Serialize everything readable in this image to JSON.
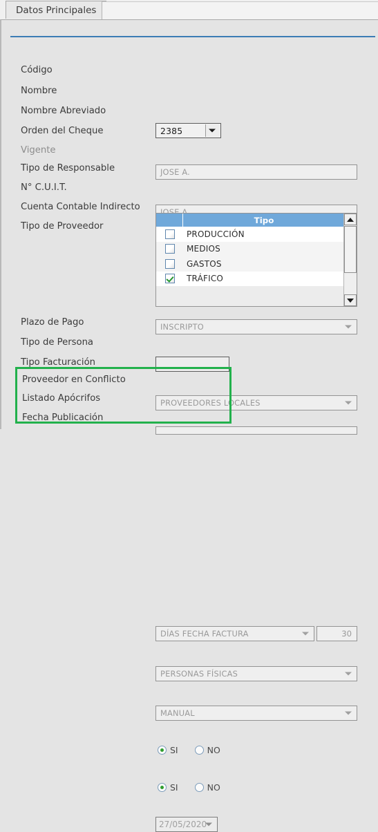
{
  "window": {
    "tab_label": "Datos Principales"
  },
  "form": {
    "rows": [
      {
        "label": "Código",
        "value": "2385",
        "control": "combo-enabled"
      },
      {
        "label": "Nombre",
        "value": "JOSE A.",
        "control": "text"
      },
      {
        "label": "Nombre Abreviado",
        "value": "JOSE A.",
        "control": "text"
      },
      {
        "label": "Orden del Cheque",
        "value": "JOSE A.",
        "control": "text"
      },
      {
        "label": "Vigente",
        "value": "",
        "control": "radio"
      },
      {
        "label": "Tipo de Responsable",
        "value": "INSCRIPTO",
        "control": "combo"
      },
      {
        "label": "N° C.U.I.T.",
        "value": "",
        "control": "text-empty"
      },
      {
        "label": "Cuenta Contable Indirecto",
        "value": "PROVEEDORES LOCALES",
        "control": "combo"
      },
      {
        "label": "Tipo de Proveedor",
        "value": "",
        "control": "grid"
      },
      {
        "label": "Plazo de Pago",
        "value": "DÍAS FECHA FACTURA",
        "control": "combo-num"
      },
      {
        "label": "Tipo de Persona",
        "value": "PERSONAS FÍSICAS",
        "control": "combo"
      },
      {
        "label": "Tipo Facturación",
        "value": "MANUAL",
        "control": "combo"
      },
      {
        "label": "Proveedor en Conflicto",
        "value": "",
        "control": "radio"
      },
      {
        "label": "Listado Apócrifos",
        "value": "",
        "control": "radio"
      },
      {
        "label": "Fecha Publicación",
        "value": "27/05/2020",
        "control": "date"
      }
    ],
    "plazo_dias": "30",
    "radio_labels": {
      "yes": "SI",
      "no": "NO"
    },
    "vigente_selected": "NO",
    "conflicto_selected": "SI",
    "apocrifos_selected": "SI"
  },
  "grid": {
    "header_blank": "",
    "header_tipo": "Tipo",
    "rows": [
      {
        "label": "PRODUCCIÓN",
        "checked": false
      },
      {
        "label": "MEDIOS",
        "checked": false
      },
      {
        "label": "GASTOS",
        "checked": false
      },
      {
        "label": "TRÁFICO",
        "checked": true
      }
    ]
  },
  "colors": {
    "accent_rule": "#3b7cb5",
    "grid_header": "#6fa8da",
    "highlight_box": "#22b14c",
    "radio_dot": "#2f9e2f",
    "check_mark": "#25962f"
  }
}
